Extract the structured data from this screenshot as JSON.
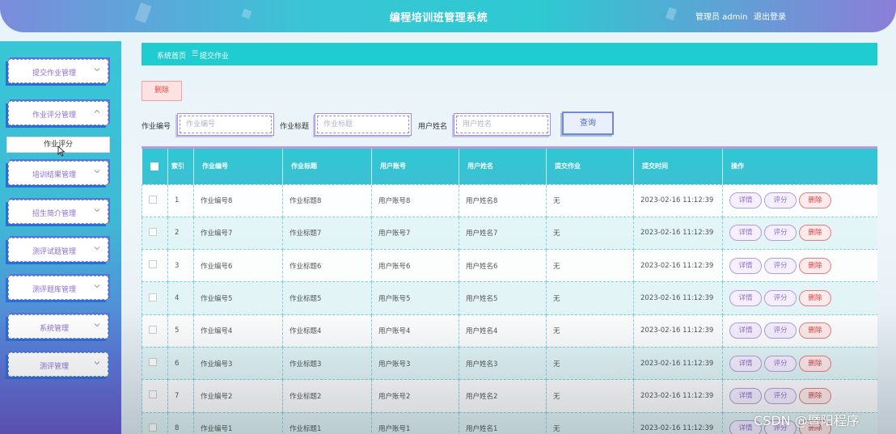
{
  "header": {
    "title": "编程培训班管理系统",
    "user": "管理员 admin",
    "logout": "退出登录"
  },
  "sidebar": {
    "items": [
      {
        "label": "提交作业管理"
      },
      {
        "label": "作业评分管理"
      },
      {
        "label": "培训结果管理"
      },
      {
        "label": "招生简介管理"
      },
      {
        "label": "测评试题管理"
      },
      {
        "label": "测评题库管理"
      },
      {
        "label": "系统管理"
      },
      {
        "label": "测评管理"
      }
    ],
    "submenu": {
      "label": "作业评分"
    }
  },
  "breadcrumb": {
    "home": "系统首页",
    "sep": "☰",
    "current": "提交作业"
  },
  "toolbar": {
    "delete_label": "删除"
  },
  "search": {
    "f1_label": "作业编号",
    "f1_placeholder": "作业编号",
    "f2_label": "作业标题",
    "f2_placeholder": "作业标题",
    "f3_label": "用户姓名",
    "f3_placeholder": "用户姓名",
    "button": "查询"
  },
  "table": {
    "headers": {
      "index": "索引",
      "col1": "作业编号",
      "col2": "作业标题",
      "col3": "用户账号",
      "col4": "用户姓名",
      "col5": "提交作业",
      "col6": "提交时间",
      "col7": "操作"
    },
    "actions": {
      "detail": "详情",
      "score": "评分",
      "delete": "删除"
    },
    "rows": [
      {
        "idx": "1",
        "no": "作业编号8",
        "title": "作业标题8",
        "account": "用户账号8",
        "name": "用户姓名8",
        "file": "无",
        "time": "2023-02-16 11:12:39"
      },
      {
        "idx": "2",
        "no": "作业编号7",
        "title": "作业标题7",
        "account": "用户账号7",
        "name": "用户姓名7",
        "file": "无",
        "time": "2023-02-16 11:12:39"
      },
      {
        "idx": "3",
        "no": "作业编号6",
        "title": "作业标题6",
        "account": "用户账号6",
        "name": "用户姓名6",
        "file": "无",
        "time": "2023-02-16 11:12:39"
      },
      {
        "idx": "4",
        "no": "作业编号5",
        "title": "作业标题5",
        "account": "用户账号5",
        "name": "用户姓名5",
        "file": "无",
        "time": "2023-02-16 11:12:39"
      },
      {
        "idx": "5",
        "no": "作业编号4",
        "title": "作业标题4",
        "account": "用户账号4",
        "name": "用户姓名4",
        "file": "无",
        "time": "2023-02-16 11:12:39"
      },
      {
        "idx": "6",
        "no": "作业编号3",
        "title": "作业标题3",
        "account": "用户账号3",
        "name": "用户姓名3",
        "file": "无",
        "time": "2023-02-16 11:12:39"
      },
      {
        "idx": "7",
        "no": "作业编号2",
        "title": "作业标题2",
        "account": "用户账号2",
        "name": "用户姓名2",
        "file": "无",
        "time": "2023-02-16 11:12:39"
      },
      {
        "idx": "8",
        "no": "作业编号1",
        "title": "作业标题1",
        "account": "用户账号1",
        "name": "用户姓名1",
        "file": "无",
        "time": "2023-02-16 11:12:39"
      }
    ]
  },
  "watermark": "CSDN @暨阳程序"
}
